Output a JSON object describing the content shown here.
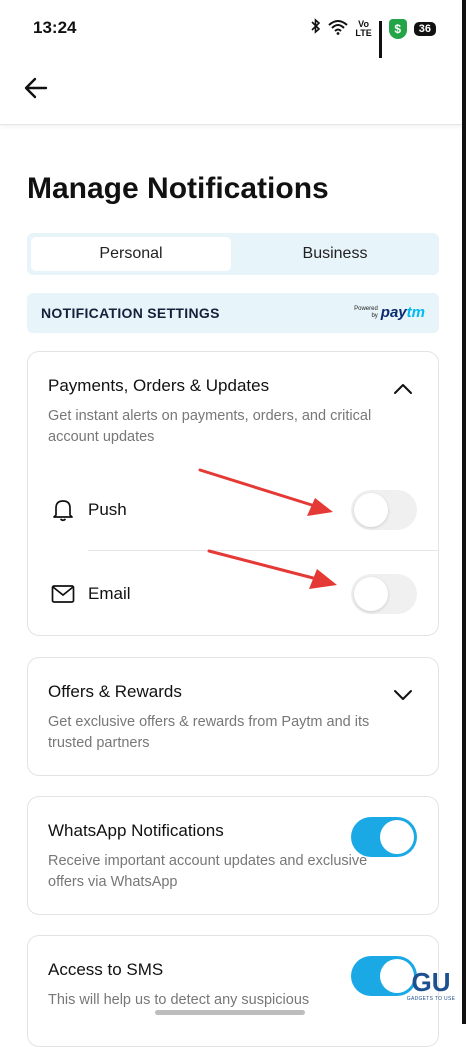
{
  "status_bar": {
    "time": "13:24",
    "network_label": "Vo\nLTE",
    "shield_glyph": "$",
    "battery": "36"
  },
  "header": {
    "back_icon": "arrow-left-icon"
  },
  "page": {
    "title": "Manage Notifications"
  },
  "tabs": [
    {
      "label": "Personal",
      "active": true
    },
    {
      "label": "Business",
      "active": false
    }
  ],
  "banner": {
    "title": "NOTIFICATION SETTINGS",
    "powered_by": "Powered\nby",
    "brand_left": "pay",
    "brand_right": "tm"
  },
  "sections": {
    "payments": {
      "title": "Payments, Orders & Updates",
      "description": "Get instant alerts on payments, orders, and critical account updates",
      "expanded": true,
      "channels": [
        {
          "label": "Push",
          "icon": "bell-icon",
          "enabled": false
        },
        {
          "label": "Email",
          "icon": "mail-icon",
          "enabled": false
        }
      ]
    },
    "offers": {
      "title": "Offers & Rewards",
      "description": "Get exclusive offers & rewards from Paytm and its trusted partners",
      "expanded": false
    },
    "whatsapp": {
      "title": "WhatsApp Notifications",
      "description": "Receive important account updates and exclusive offers via WhatsApp",
      "enabled": true
    },
    "sms": {
      "title": "Access to SMS",
      "description": "This will help us to detect any suspicious",
      "enabled": true
    }
  },
  "watermark": {
    "logo": "GU",
    "text": "GADGETS TO USE"
  },
  "colors": {
    "accent": "#1ba9e6",
    "tab_bg": "#e7f5fb",
    "arrow": "#e53935"
  }
}
